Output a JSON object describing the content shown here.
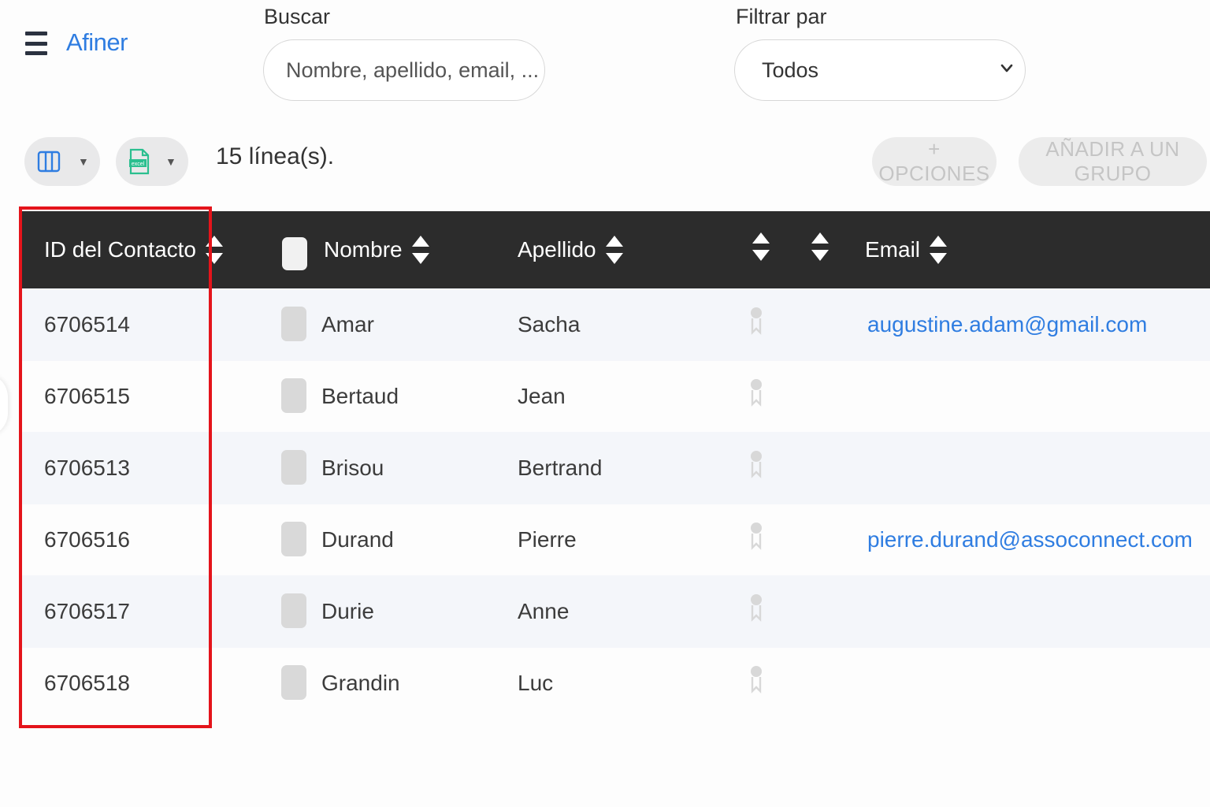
{
  "header": {
    "brand": "Afiner",
    "search_label": "Buscar",
    "search_placeholder": "Nombre, apellido, email, ...",
    "filter_label": "Filtrar par",
    "filter_value": "Todos"
  },
  "toolbar": {
    "columns_icon": "columns-icon",
    "excel_icon": "excel-export-icon",
    "excel_text": "excel",
    "line_count": "15 línea(s).",
    "options_label": "+ OPCIONES",
    "add_group_label": "AÑADIR A UN GRUPO"
  },
  "table": {
    "headers": {
      "id": "ID del Contacto",
      "first_name": "Nombre",
      "last_name": "Apellido",
      "email": "Email"
    },
    "rows": [
      {
        "id": "6706514",
        "first_name": "Amar",
        "last_name": "Sacha",
        "email": "augustine.adam@gmail.com"
      },
      {
        "id": "6706515",
        "first_name": "Bertaud",
        "last_name": "Jean",
        "email": ""
      },
      {
        "id": "6706513",
        "first_name": "Brisou",
        "last_name": "Bertrand",
        "email": ""
      },
      {
        "id": "6706516",
        "first_name": "Durand",
        "last_name": "Pierre",
        "email": "pierre.durand@assoconnect.com"
      },
      {
        "id": "6706517",
        "first_name": "Durie",
        "last_name": "Anne",
        "email": ""
      },
      {
        "id": "6706518",
        "first_name": "Grandin",
        "last_name": "Luc",
        "email": ""
      }
    ]
  },
  "colors": {
    "accent": "#2f7de1",
    "header_bg": "#2c2c2c",
    "highlight": "#e4141b"
  }
}
